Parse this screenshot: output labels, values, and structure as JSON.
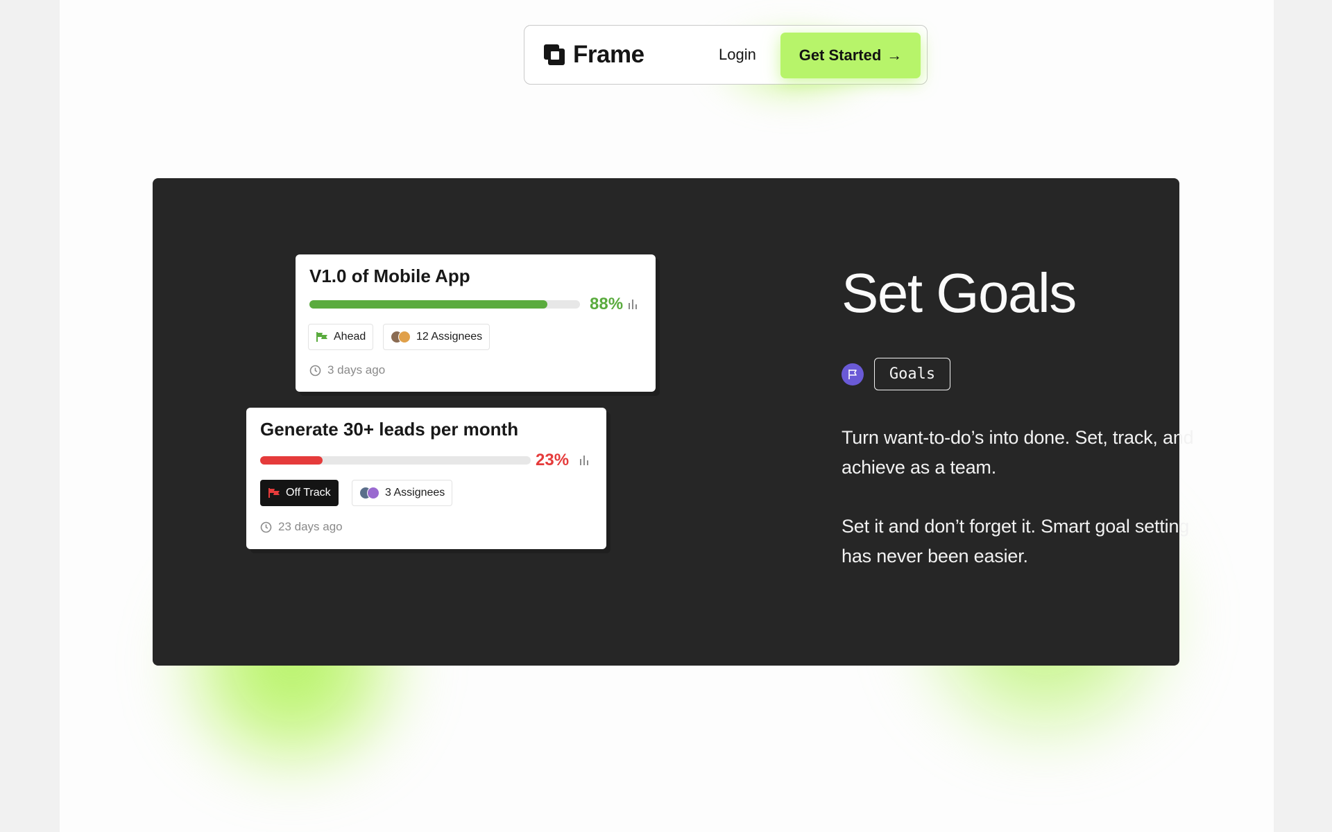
{
  "nav": {
    "brand": "Frame",
    "login_label": "Login",
    "cta_label": "Get Started",
    "cta_arrow": "→"
  },
  "cards": [
    {
      "title": "V1.0 of Mobile App",
      "progress_percent": 88,
      "progress_label": "88%",
      "progress_color": "#5aab3e",
      "status_label": "Ahead",
      "status_icon": "flag-icon",
      "status_color": "#5aab3e",
      "assignees_label": "12 Assignees",
      "time_label": "3 days ago"
    },
    {
      "title": "Generate 30+ leads per month",
      "progress_percent": 23,
      "progress_label": "23%",
      "progress_color": "#e53b3b",
      "status_label": "Off Track",
      "status_icon": "flag-icon",
      "status_color": "#e53b3b",
      "assignees_label": "3 Assignees",
      "time_label": "23 days ago"
    }
  ],
  "feature": {
    "heading": "Set Goals",
    "chip_label": "Goals",
    "paragraph_1": "Turn want-to-do’s into done. Set, track, and achieve as a team.",
    "paragraph_2": "Set it and don’t forget it. Smart goal setting has never been easier."
  },
  "colors": {
    "accent": "#b7f46a",
    "dark_bg": "#262626",
    "goal_icon_bg": "#6a5ad6"
  }
}
